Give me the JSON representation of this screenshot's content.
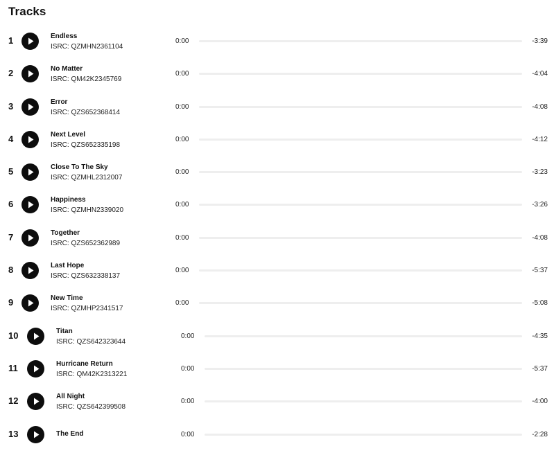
{
  "section_title": "Tracks",
  "colors": {
    "play_button": "#0d0d0d",
    "progress_track": "#eeeeee"
  },
  "icons": {
    "play": "play-icon"
  },
  "tracks": [
    {
      "number": "1",
      "title": "Endless",
      "isrc": "ISRC: QZMHN2361104",
      "current_time": "0:00",
      "remaining": "-3:39",
      "progress": 0
    },
    {
      "number": "2",
      "title": "No Matter",
      "isrc": "ISRC: QM42K2345769",
      "current_time": "0:00",
      "remaining": "-4:04",
      "progress": 0
    },
    {
      "number": "3",
      "title": "Error",
      "isrc": "ISRC: QZS652368414",
      "current_time": "0:00",
      "remaining": "-4:08",
      "progress": 0
    },
    {
      "number": "4",
      "title": "Next Level",
      "isrc": "ISRC: QZS652335198",
      "current_time": "0:00",
      "remaining": "-4:12",
      "progress": 0
    },
    {
      "number": "5",
      "title": "Close To The Sky",
      "isrc": "ISRC: QZMHL2312007",
      "current_time": "0:00",
      "remaining": "-3:23",
      "progress": 0
    },
    {
      "number": "6",
      "title": "Happiness",
      "isrc": "ISRC: QZMHN2339020",
      "current_time": "0:00",
      "remaining": "-3:26",
      "progress": 0
    },
    {
      "number": "7",
      "title": "Together",
      "isrc": "ISRC: QZS652362989",
      "current_time": "0:00",
      "remaining": "-4:08",
      "progress": 0
    },
    {
      "number": "8",
      "title": "Last Hope",
      "isrc": "ISRC: QZS632338137",
      "current_time": "0:00",
      "remaining": "-5:37",
      "progress": 0
    },
    {
      "number": "9",
      "title": "New Time",
      "isrc": "ISRC: QZMHP2341517",
      "current_time": "0:00",
      "remaining": "-5:08",
      "progress": 0
    },
    {
      "number": "10",
      "title": "Titan",
      "isrc": "ISRC: QZS642323644",
      "current_time": "0:00",
      "remaining": "-4:35",
      "progress": 0
    },
    {
      "number": "11",
      "title": "Hurricane Return",
      "isrc": "ISRC: QM42K2313221",
      "current_time": "0:00",
      "remaining": "-5:37",
      "progress": 0
    },
    {
      "number": "12",
      "title": "All Night",
      "isrc": "ISRC: QZS642399508",
      "current_time": "0:00",
      "remaining": "-4:00",
      "progress": 0
    },
    {
      "number": "13",
      "title": "The End",
      "isrc": "",
      "current_time": "0:00",
      "remaining": "-2:28",
      "progress": 0
    }
  ]
}
